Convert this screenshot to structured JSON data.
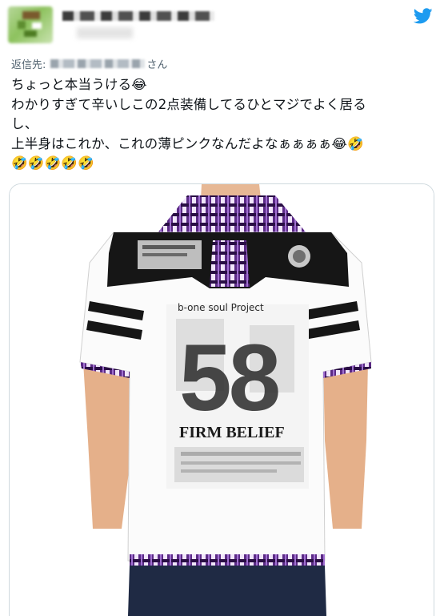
{
  "tweet": {
    "reply_prefix": "返信先:",
    "reply_suffix": "さん",
    "lines": [
      "ちょっと本当うける😂",
      "わかりすぎて辛いしこの2点装備してるひとマジでよく居る",
      "し、",
      "上半身はこれか、これの薄ピンクなんだよなぁぁぁぁ😂🤣",
      "🤣🤣🤣🤣🤣"
    ]
  },
  "shirt": {
    "text_top": "b-one soul Project",
    "big_number": "58",
    "slogan": "FIRM BELIEF"
  },
  "colors": {
    "twitter_blue": "#1d9bf0",
    "plaid_purple": "#5b2a86",
    "shirt_black": "#161616"
  },
  "icons": [
    "twitter-bird-icon"
  ]
}
